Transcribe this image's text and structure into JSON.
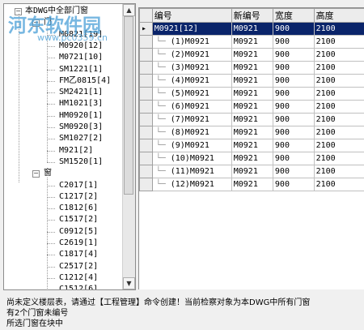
{
  "tree": {
    "root_label": "本DWG中全部门窗",
    "door_group_label": "门",
    "door_items": [
      "M0821[19]",
      "M0920[12]",
      "M0721[10]",
      "SM1221[1]",
      "FM乙0815[4]",
      "SM2421[1]",
      "HM1021[3]",
      "HM0920[1]",
      "SM0920[3]",
      "SM1027[2]",
      "M921[2]",
      "SM1520[1]"
    ],
    "window_group_label": "窗",
    "window_items": [
      "C2017[1]",
      "C1217[2]",
      "C1812[6]",
      "C1517[2]",
      "C0912[5]",
      "C2619[1]",
      "C1817[4]",
      "C2517[2]",
      "C1212[4]",
      "C1512[6]"
    ]
  },
  "grid": {
    "headers": [
      "编号",
      "新编号",
      "宽度",
      "高度"
    ],
    "selected_row": {
      "id": "M0921[12]",
      "new_id": "M0921",
      "width": "900",
      "height": "2100"
    },
    "rows": [
      {
        "id": "(1)M0921",
        "new_id": "M0921",
        "width": "900",
        "height": "2100"
      },
      {
        "id": "(2)M0921",
        "new_id": "M0921",
        "width": "900",
        "height": "2100"
      },
      {
        "id": "(3)M0921",
        "new_id": "M0921",
        "width": "900",
        "height": "2100"
      },
      {
        "id": "(4)M0921",
        "new_id": "M0921",
        "width": "900",
        "height": "2100"
      },
      {
        "id": "(5)M0921",
        "new_id": "M0921",
        "width": "900",
        "height": "2100"
      },
      {
        "id": "(6)M0921",
        "new_id": "M0921",
        "width": "900",
        "height": "2100"
      },
      {
        "id": "(7)M0921",
        "new_id": "M0921",
        "width": "900",
        "height": "2100"
      },
      {
        "id": "(8)M0921",
        "new_id": "M0921",
        "width": "900",
        "height": "2100"
      },
      {
        "id": "(9)M0921",
        "new_id": "M0921",
        "width": "900",
        "height": "2100"
      },
      {
        "id": "(10)M0921",
        "new_id": "M0921",
        "width": "900",
        "height": "2100"
      },
      {
        "id": "(11)M0921",
        "new_id": "M0921",
        "width": "900",
        "height": "2100"
      },
      {
        "id": "(12)M0921",
        "new_id": "M0921",
        "width": "900",
        "height": "2100"
      }
    ]
  },
  "status": {
    "line1": "尚未定义楼层表，请通过【工程管理】命令创建！当前检察对象为本DWG中所有门窗",
    "line2": "有2个门窗未编号",
    "line3": "所选门窗在块中"
  },
  "watermark": {
    "line1": "河东软件园",
    "line2": "www.pc0359.cn"
  },
  "colors": {
    "selection": "#0a246a",
    "watermark": "#4aa0d8"
  }
}
